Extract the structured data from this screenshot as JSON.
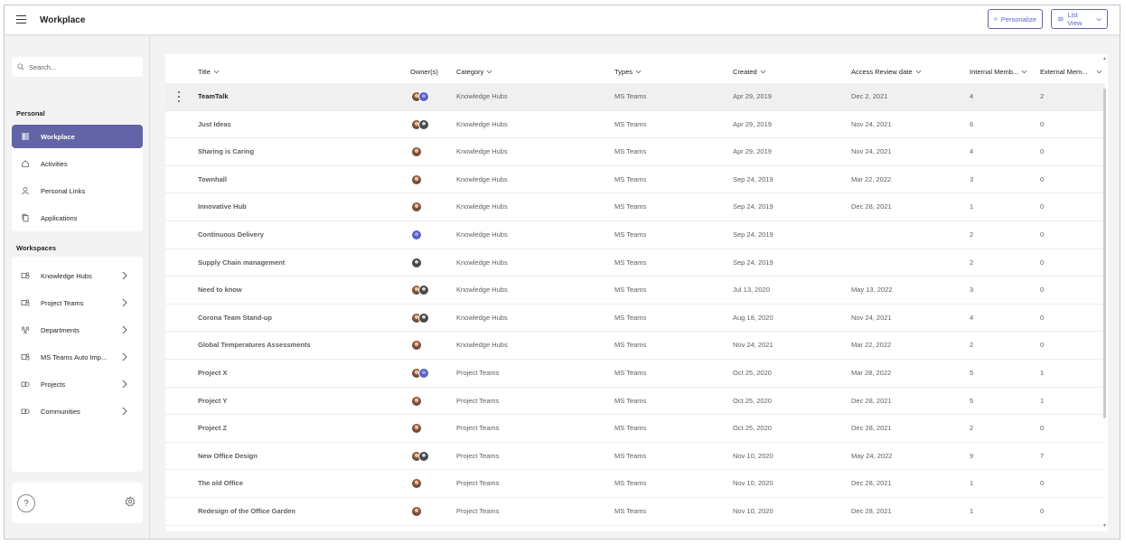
{
  "app": {
    "title": "Workplace",
    "personalize_label": "Personalize",
    "listview_label": "List View"
  },
  "sidebar": {
    "search_placeholder": "Search...",
    "personal_label": "Personal",
    "personal_items": [
      {
        "label": "Workplace",
        "icon": "grid-icon",
        "active": true
      },
      {
        "label": "Activities",
        "icon": "home-icon",
        "active": false
      },
      {
        "label": "Personal Links",
        "icon": "person-icon",
        "active": false
      },
      {
        "label": "Applications",
        "icon": "copy-icon",
        "active": false
      }
    ],
    "workspaces_label": "Workspaces",
    "workspace_items": [
      {
        "label": "Knowledge Hubs",
        "icon": "teams-icon"
      },
      {
        "label": "Project Teams",
        "icon": "teams-icon"
      },
      {
        "label": "Departments",
        "icon": "org-icon"
      },
      {
        "label": "MS Teams Auto Imp...",
        "icon": "teams-icon"
      },
      {
        "label": "Projects",
        "icon": "project-icon"
      },
      {
        "label": "Communities",
        "icon": "project-icon"
      }
    ],
    "help_label": "?"
  },
  "table": {
    "columns": [
      {
        "label": "Title",
        "sortable": true
      },
      {
        "label": "Owner(s)",
        "sortable": false
      },
      {
        "label": "Category",
        "sortable": true
      },
      {
        "label": "Types",
        "sortable": true
      },
      {
        "label": "Created",
        "sortable": true
      },
      {
        "label": "Access Review date",
        "sortable": true
      },
      {
        "label": "Internal Memb...",
        "sortable": true
      },
      {
        "label": "External Mem...",
        "sortable": true
      }
    ],
    "rows": [
      {
        "title": "TeamTalk",
        "owners": [
          "photo",
          "purple"
        ],
        "category": "Knowledge Hubs",
        "type": "MS Teams",
        "created": "Apr 29, 2019",
        "review": "Dec 2, 2021",
        "internal": "4",
        "external": "2"
      },
      {
        "title": "Just Ideas",
        "owners": [
          "photo",
          "dark"
        ],
        "category": "Knowledge Hubs",
        "type": "MS Teams",
        "created": "Apr 29, 2019",
        "review": "Nov 24, 2021",
        "internal": "6",
        "external": "0"
      },
      {
        "title": "Sharing is Caring",
        "owners": [
          "photo"
        ],
        "category": "Knowledge Hubs",
        "type": "MS Teams",
        "created": "Apr 29, 2019",
        "review": "Nov 24, 2021",
        "internal": "4",
        "external": "0"
      },
      {
        "title": "Townhall",
        "owners": [
          "photo"
        ],
        "category": "Knowledge Hubs",
        "type": "MS Teams",
        "created": "Sep 24, 2019",
        "review": "Mar 22, 2022",
        "internal": "3",
        "external": "0"
      },
      {
        "title": "Innovative Hub",
        "owners": [
          "photo"
        ],
        "category": "Knowledge Hubs",
        "type": "MS Teams",
        "created": "Sep 24, 2019",
        "review": "Dec 28, 2021",
        "internal": "1",
        "external": "0"
      },
      {
        "title": "Continuous Delivery",
        "owners": [
          "purple"
        ],
        "category": "Knowledge Hubs",
        "type": "MS Teams",
        "created": "Sep 24, 2019",
        "review": "",
        "internal": "2",
        "external": "0"
      },
      {
        "title": "Supply Chain management",
        "owners": [
          "dark"
        ],
        "category": "Knowledge Hubs",
        "type": "MS Teams",
        "created": "Sep 24, 2019",
        "review": "",
        "internal": "2",
        "external": "0"
      },
      {
        "title": "Need to know",
        "owners": [
          "photo",
          "dark"
        ],
        "category": "Knowledge Hubs",
        "type": "MS Teams",
        "created": "Jul 13, 2020",
        "review": "May 13, 2022",
        "internal": "3",
        "external": "0"
      },
      {
        "title": "Corona Team Stand-up",
        "owners": [
          "photo",
          "dark"
        ],
        "category": "Knowledge Hubs",
        "type": "MS Teams",
        "created": "Aug 18, 2020",
        "review": "Nov 24, 2021",
        "internal": "4",
        "external": "0"
      },
      {
        "title": "Global Temperatures Assessments",
        "owners": [
          "photo"
        ],
        "category": "Knowledge Hubs",
        "type": "MS Teams",
        "created": "Nov 24, 2021",
        "review": "Mar 22, 2022",
        "internal": "2",
        "external": "0"
      },
      {
        "title": "Project X",
        "owners": [
          "photo",
          "purple"
        ],
        "category": "Project Teams",
        "type": "MS Teams",
        "created": "Oct 25, 2020",
        "review": "Mar 28, 2022",
        "internal": "5",
        "external": "1"
      },
      {
        "title": "Project Y",
        "owners": [
          "photo"
        ],
        "category": "Project Teams",
        "type": "MS Teams",
        "created": "Oct 25, 2020",
        "review": "Dec 28, 2021",
        "internal": "5",
        "external": "1"
      },
      {
        "title": "Project Z",
        "owners": [
          "photo"
        ],
        "category": "Project Teams",
        "type": "MS Teams",
        "created": "Oct 25, 2020",
        "review": "Dec 28, 2021",
        "internal": "2",
        "external": "0"
      },
      {
        "title": "New Office Design",
        "owners": [
          "photo",
          "dark"
        ],
        "category": "Project Teams",
        "type": "MS Teams",
        "created": "Nov 10, 2020",
        "review": "May 24, 2022",
        "internal": "9",
        "external": "7"
      },
      {
        "title": "The old Office",
        "owners": [
          "photo"
        ],
        "category": "Project Teams",
        "type": "MS Teams",
        "created": "Nov 10, 2020",
        "review": "Dec 28, 2021",
        "internal": "1",
        "external": "0"
      },
      {
        "title": "Redesign of the Office Garden",
        "owners": [
          "photo"
        ],
        "category": "Project Teams",
        "type": "MS Teams",
        "created": "Nov 10, 2020",
        "review": "Dec 28, 2021",
        "internal": "1",
        "external": "0"
      }
    ]
  },
  "colors": {
    "accent": "#6264a7",
    "accent_text": "#5b5fc7"
  }
}
